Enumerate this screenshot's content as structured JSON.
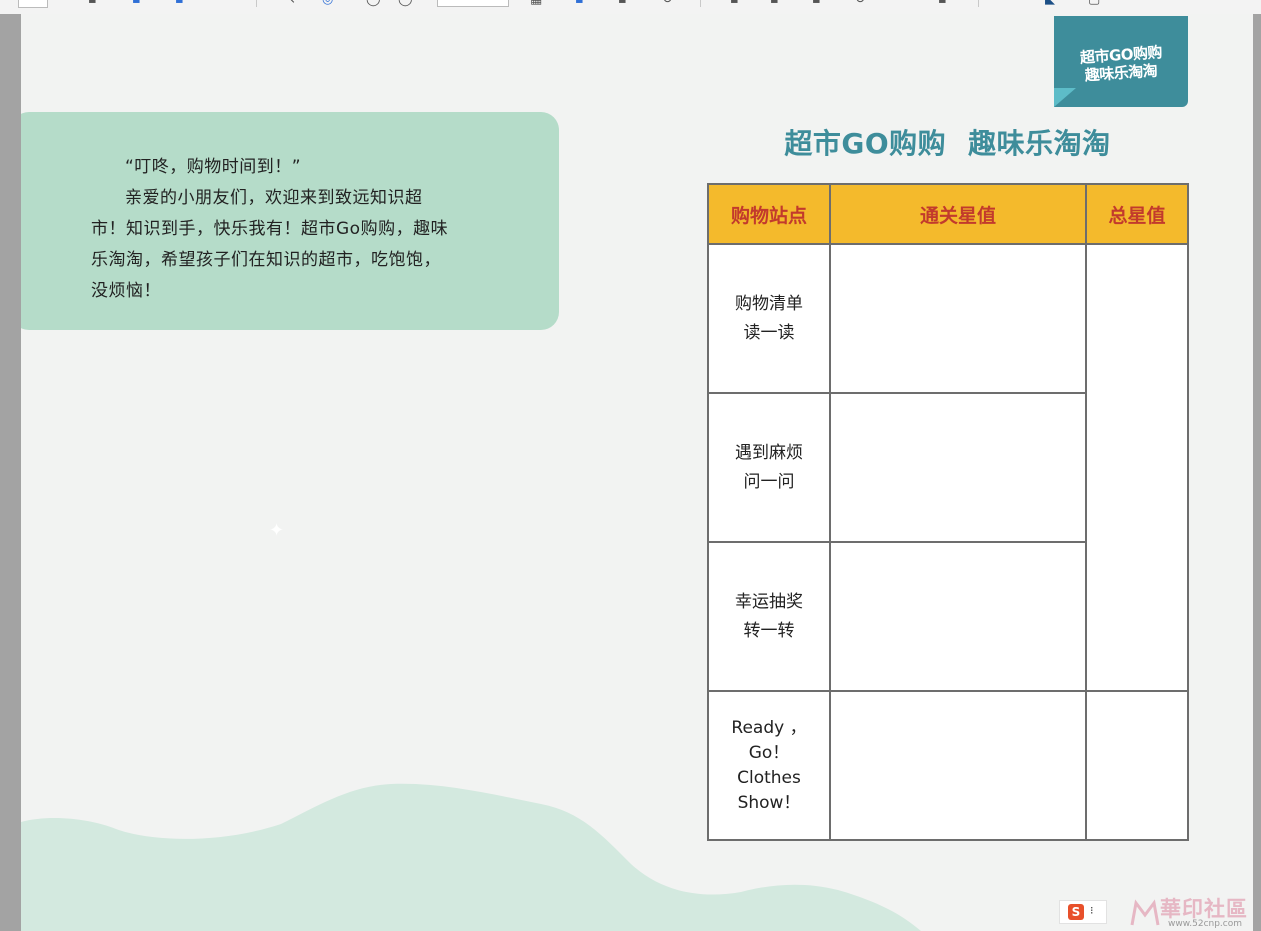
{
  "toolbar": {
    "page_field_value": ""
  },
  "brand_tag": {
    "line1": "超市GO购购",
    "line2": "趣味乐淘淘"
  },
  "intro": {
    "quote": "“叮咚，购物时间到！”",
    "body": "亲爱的小朋友们，欢迎来到致远知识超市！知识到手，快乐我有！超市Go购购，趣味乐淘淘，希望孩子们在知识的超市，吃饱饱，没烦恼！"
  },
  "title": {
    "left": "超市GO购购",
    "right": "趣味乐淘淘"
  },
  "score_table": {
    "headers": [
      "购物站点",
      "通关星值",
      "总星值"
    ],
    "rows": [
      {
        "station_line1": "购物清单",
        "station_line2": "读一读"
      },
      {
        "station_line1": "遇到麻烦",
        "station_line2": "问一问"
      },
      {
        "station_line1": "幸运抽奖",
        "station_line2": "转一转"
      },
      {
        "station_line1": "Ready ，Go！",
        "station_line2": "Clothes Show！"
      }
    ]
  },
  "ime": {
    "icon_label": "S",
    "menu": "⁝"
  },
  "watermark": {
    "site_name": "華印社區",
    "url": "www.52cnp.com"
  },
  "colors": {
    "page_bg": "#f2f3f2",
    "card_green": "#b5dcc9",
    "hill_green": "#d3e9df",
    "teal": "#3e8d9b",
    "header_yellow": "#f4ba2c",
    "header_text_red": "#c23a2c"
  }
}
